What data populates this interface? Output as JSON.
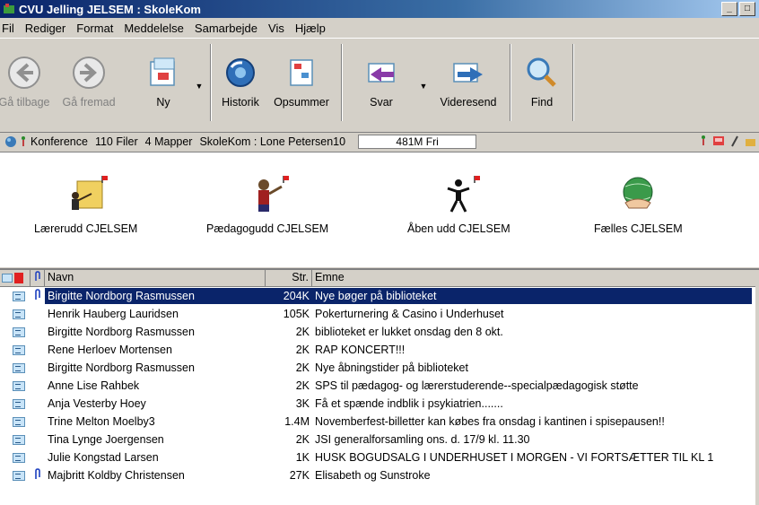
{
  "window": {
    "title": "CVU Jelling JELSEM : SkoleKom",
    "btn_min": "_",
    "btn_max": "□"
  },
  "menu": [
    "Fil",
    "Rediger",
    "Format",
    "Meddelelse",
    "Samarbejde",
    "Vis",
    "Hjælp"
  ],
  "toolbar": {
    "back": "Gå tilbage",
    "forward": "Gå fremad",
    "new": "Ny",
    "history": "Historik",
    "summarize": "Opsummer",
    "reply": "Svar",
    "forward_msg": "Videresend",
    "find": "Find",
    "dropdown_glyph": "▼"
  },
  "location": {
    "conference": "Konference",
    "files": "110 Filer",
    "folders": "4 Mapper",
    "path": "SkoleKom : Lone Petersen10",
    "free": "481M Fri"
  },
  "conferences": [
    {
      "label": "Lærerudd CJELSEM",
      "icon": "teacher-icon"
    },
    {
      "label": "Pædagogudd CJELSEM",
      "icon": "pedagogue-icon"
    },
    {
      "label": "Åben udd CJELSEM",
      "icon": "person-icon"
    },
    {
      "label": "Fælles CJELSEM",
      "icon": "globe-handshake-icon"
    }
  ],
  "list": {
    "columns": {
      "name": "Navn",
      "size": "Str.",
      "subject": "Emne"
    },
    "rows": [
      {
        "name": "Birgitte Nordborg Rasmussen",
        "size": "204K",
        "subject": "Nye bøger på biblioteket",
        "attachment": true,
        "selected": true
      },
      {
        "name": "Henrik Hauberg Lauridsen",
        "size": "105K",
        "subject": "Pokerturnering & Casino i Underhuset",
        "attachment": false,
        "selected": false
      },
      {
        "name": "Birgitte Nordborg Rasmussen",
        "size": "2K",
        "subject": "biblioteket er lukket onsdag den 8 okt.",
        "attachment": false,
        "selected": false
      },
      {
        "name": "Rene Herloev Mortensen",
        "size": "2K",
        "subject": "RAP KONCERT!!!",
        "attachment": false,
        "selected": false
      },
      {
        "name": "Birgitte Nordborg Rasmussen",
        "size": "2K",
        "subject": "Nye åbningstider på biblioteket",
        "attachment": false,
        "selected": false
      },
      {
        "name": "Anne Lise Rahbek",
        "size": "2K",
        "subject": "SPS til pædagog- og lærerstuderende--specialpædagogisk støtte",
        "attachment": false,
        "selected": false
      },
      {
        "name": "Anja Vesterby Hoey",
        "size": "3K",
        "subject": "Få et spænde indblik i psykiatrien.......",
        "attachment": false,
        "selected": false
      },
      {
        "name": "Trine Melton Moelby3",
        "size": "1.4M",
        "subject": "Novemberfest-billetter kan købes fra onsdag i kantinen i spisepausen!!",
        "attachment": false,
        "selected": false
      },
      {
        "name": "Tina Lynge Joergensen",
        "size": "2K",
        "subject": "JSI generalforsamling ons. d. 17/9 kl. 11.30",
        "attachment": false,
        "selected": false
      },
      {
        "name": "Julie Kongstad Larsen",
        "size": "1K",
        "subject": "HUSK BOGUDSALG I UNDERHUSET I MORGEN - VI FORTSÆTTER TIL KL 1",
        "attachment": false,
        "selected": false
      },
      {
        "name": "Majbritt Koldby Christensen",
        "size": "27K",
        "subject": "Elisabeth og Sunstroke",
        "attachment": true,
        "selected": false
      }
    ]
  }
}
